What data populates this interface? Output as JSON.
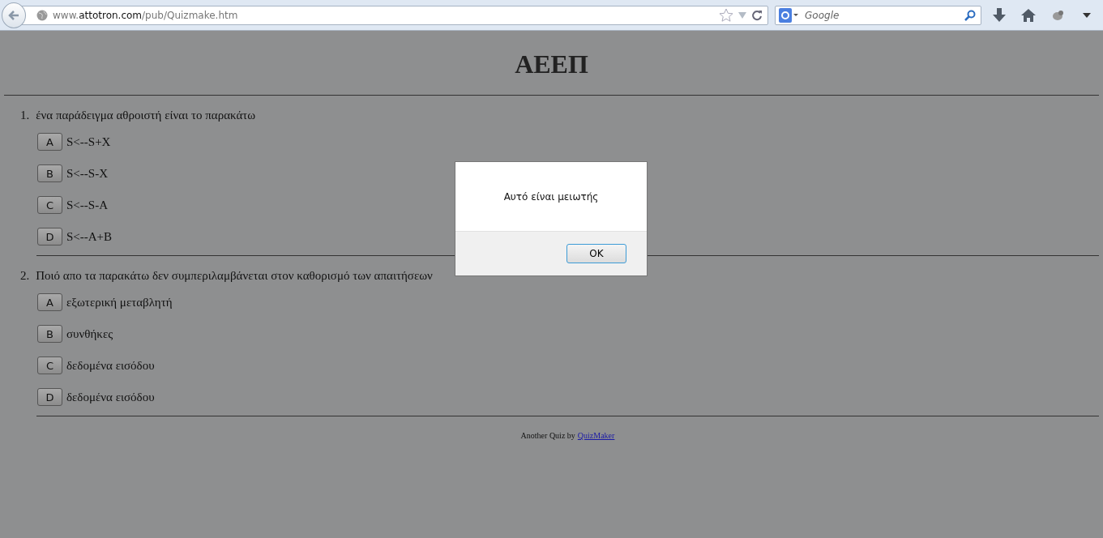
{
  "browser": {
    "url": {
      "prefix": "www.",
      "domain": "attotron.com",
      "path": "/pub/Quizmake.htm"
    },
    "search": {
      "placeholder": "Google"
    }
  },
  "page": {
    "title": "ΑΕΕΠ",
    "questions": [
      {
        "number": "1.",
        "text": "ένα παράδειγμα αθροιστή είναι το παρακάτω",
        "options": [
          {
            "letter": "A",
            "text": "S<--S+X"
          },
          {
            "letter": "B",
            "text": "S<--S-X"
          },
          {
            "letter": "C",
            "text": "S<--S-A"
          },
          {
            "letter": "D",
            "text": "S<--A+B"
          }
        ]
      },
      {
        "number": "2.",
        "text": "Ποιό απο τα παρακάτω δεν συμπεριλαμβάνεται στον καθορισμό των απαιτήσεων",
        "options": [
          {
            "letter": "A",
            "text": "εξωτερική μεταβλητή"
          },
          {
            "letter": "B",
            "text": "συνθήκες"
          },
          {
            "letter": "C",
            "text": "δεδομένα εισόδου"
          },
          {
            "letter": "D",
            "text": "δεδομένα εισόδου"
          }
        ]
      }
    ],
    "footer": {
      "text": "Another Quiz by",
      "link": "QuizMaker"
    }
  },
  "dialog": {
    "message": "Αυτό είναι μειωτής",
    "button": "OK"
  }
}
